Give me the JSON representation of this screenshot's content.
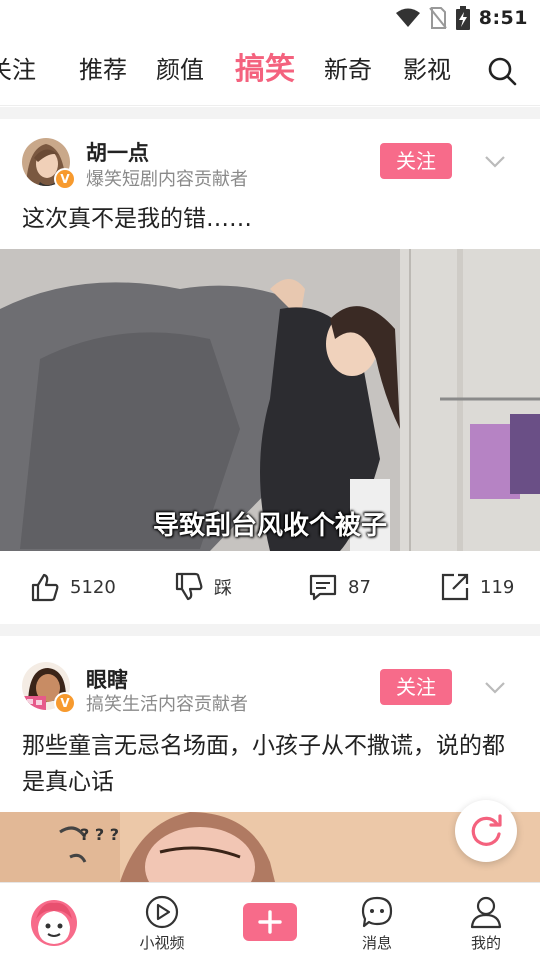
{
  "status_bar": {
    "time": "8:51"
  },
  "tabs": [
    {
      "label": "关注"
    },
    {
      "label": "推荐"
    },
    {
      "label": "颜值"
    },
    {
      "label": "搞笑",
      "active": true
    },
    {
      "label": "新奇"
    },
    {
      "label": "影视"
    }
  ],
  "accent_color": "#f76b8a",
  "posts": [
    {
      "author": "胡一点",
      "author_desc": "爆笑短剧内容贡献者",
      "follow_label": "关注",
      "title": "这次真不是我的错……",
      "subtitle": "导致刮台风收个被子",
      "likes": "5120",
      "dislike_label": "踩",
      "comments": "87",
      "shares": "119"
    },
    {
      "author": "眼瞎",
      "author_desc": "搞笑生活内容贡献者",
      "follow_label": "关注",
      "title": "那些童言无忌名场面，小孩子从不撒谎，说的都是真心话"
    }
  ],
  "bottom_nav": [
    {
      "label": ""
    },
    {
      "label": "小视频"
    },
    {
      "label": ""
    },
    {
      "label": "消息"
    },
    {
      "label": "我的"
    }
  ]
}
